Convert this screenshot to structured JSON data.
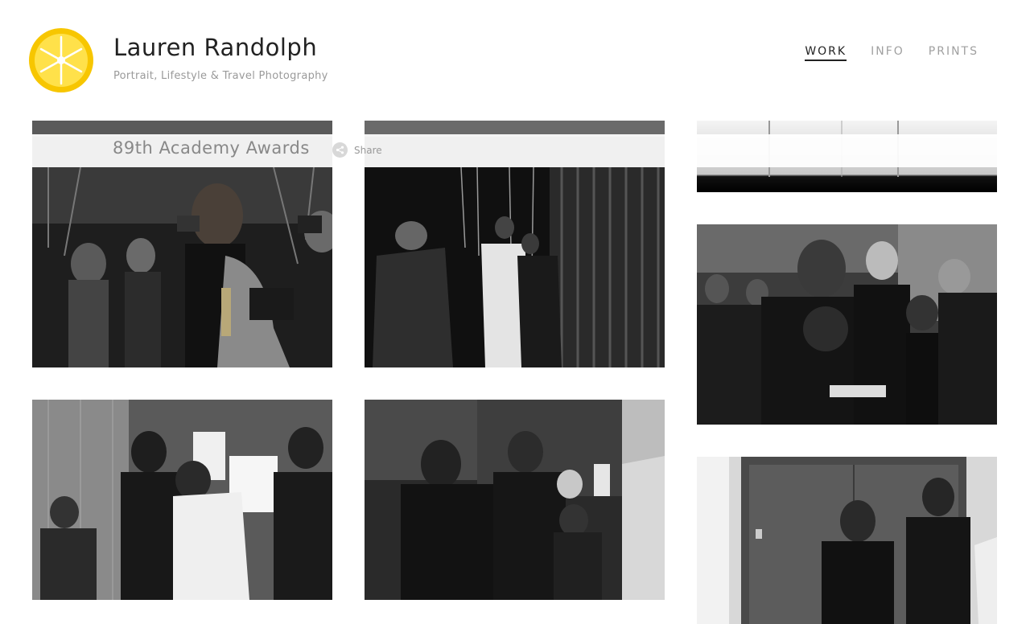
{
  "site": {
    "title": "Lauren Randolph",
    "tagline": "Portrait, Lifestyle & Travel Photography",
    "logo_icon": "lemon-slice-logo-icon",
    "logo_color": "#f7c600"
  },
  "nav": {
    "items": [
      {
        "label": "WORK",
        "active": true
      },
      {
        "label": "INFO",
        "active": false
      },
      {
        "label": "PRINTS",
        "active": false
      }
    ]
  },
  "gallery": {
    "title": "89th Academy Awards",
    "share_label": "Share",
    "share_icon": "share-icon"
  },
  "photos": [
    {
      "name": "photo-top-col1"
    },
    {
      "name": "photo-top-col2"
    },
    {
      "name": "photo-top-col3"
    },
    {
      "name": "photo-oscar-hug"
    },
    {
      "name": "photo-backstage-curtain"
    },
    {
      "name": "photo-crowd-embrace"
    },
    {
      "name": "photo-elevator-hug"
    },
    {
      "name": "photo-handshake-celebration"
    },
    {
      "name": "photo-elevator-excited"
    }
  ]
}
